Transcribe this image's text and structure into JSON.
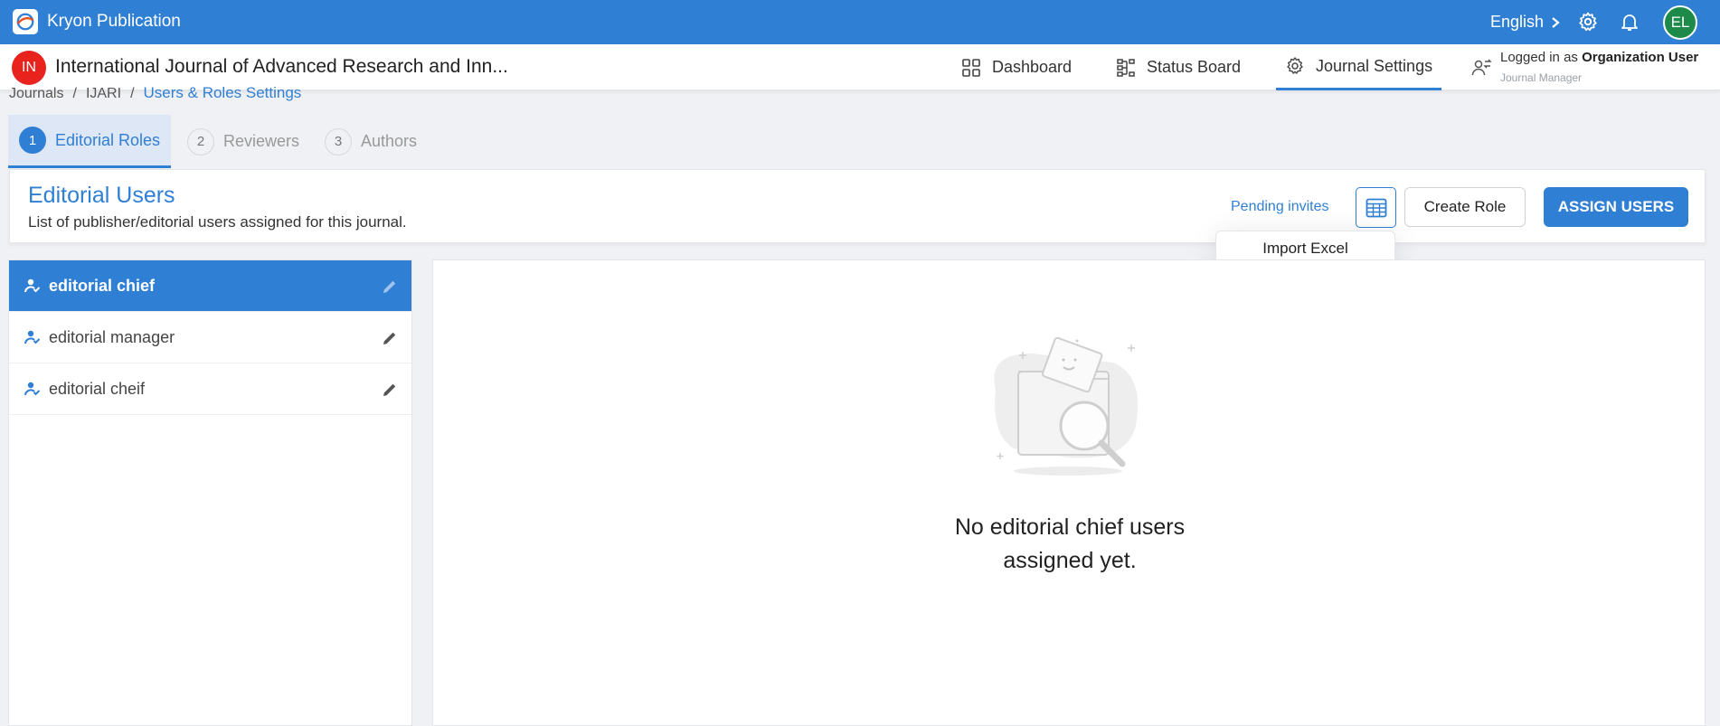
{
  "app": {
    "title": "Kryon Publication",
    "language": "English",
    "avatar_initials": "EL"
  },
  "journal": {
    "badge": "IN",
    "title": "International Journal of Advanced Research and Inn..."
  },
  "nav": {
    "dashboard": "Dashboard",
    "status_board": "Status Board",
    "journal_settings": "Journal Settings"
  },
  "login": {
    "prefix": "Logged in as",
    "user": "Organization User",
    "role": "Journal Manager"
  },
  "breadcrumb": {
    "items": [
      "Journals",
      "IJARI"
    ],
    "current": "Users & Roles Settings"
  },
  "steps": [
    {
      "num": "1",
      "label": "Editorial Roles"
    },
    {
      "num": "2",
      "label": "Reviewers"
    },
    {
      "num": "3",
      "label": "Authors"
    }
  ],
  "header": {
    "title": "Editorial Users",
    "subtitle": "List of publisher/editorial users assigned for this journal.",
    "pending_invites": "Pending invites",
    "create_role": "Create Role",
    "assign_users": "ASSIGN USERS",
    "dropdown_import": "Import Excel"
  },
  "roles": [
    {
      "label": "editorial chief"
    },
    {
      "label": "editorial manager"
    },
    {
      "label": "editorial cheif"
    }
  ],
  "empty_state": {
    "line1": "No editorial chief users",
    "line2": "assigned yet."
  },
  "colors": {
    "primary": "#2f7fd4",
    "badge_red": "#e8231d",
    "avatar_green": "#1e8a4a"
  }
}
